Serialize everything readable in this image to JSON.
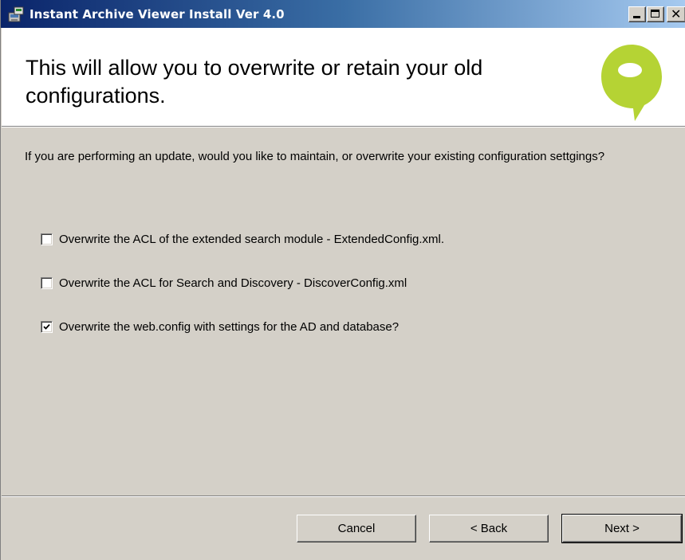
{
  "window": {
    "title": "Instant Archive Viewer Install Ver 4.0"
  },
  "title_bar": {
    "icon": "installer-icon",
    "minimize_icon": "minimize-icon",
    "maximize_icon": "maximize-icon",
    "close_icon": "close-icon"
  },
  "banner": {
    "title": "This will allow you to overwrite or retain your old configurations.",
    "logo_icon": "speech-bubble-logo",
    "logo_color": "#b5d334"
  },
  "body": {
    "description": "If you are performing an update, would you like to maintain, or overwrite your existing configuration settgings?"
  },
  "options": [
    {
      "label": "Overwrite the ACL of the extended search module -  ExtendedConfig.xml.",
      "checked": false
    },
    {
      "label": "Overwrite the ACL for Search and Discovery - DiscoverConfig.xml",
      "checked": false
    },
    {
      "label": "Overwrite the web.config with settings for the AD and database?",
      "checked": true
    }
  ],
  "buttons": {
    "cancel": "Cancel",
    "back": "< Back",
    "next": "Next >"
  },
  "colors": {
    "dialog_background": "#d4d0c8",
    "title_bar_start": "#0a246a",
    "title_bar_end": "#a6caf0",
    "banner_background": "#ffffff"
  }
}
